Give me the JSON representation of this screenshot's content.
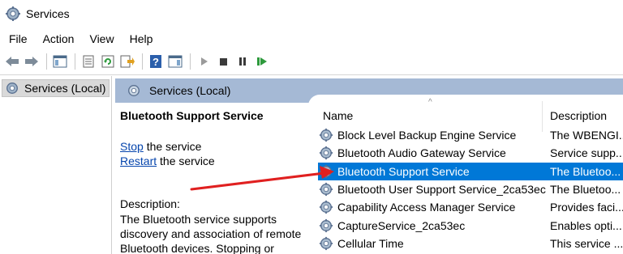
{
  "window": {
    "title": "Services"
  },
  "menu": [
    "File",
    "Action",
    "View",
    "Help"
  ],
  "tree": {
    "root_label": "Services (Local)"
  },
  "pane": {
    "header": "Services (Local)"
  },
  "detail": {
    "service_name": "Bluetooth Support Service",
    "stop_link": "Stop",
    "stop_suffix": " the service",
    "restart_link": "Restart",
    "restart_suffix": " the service",
    "description_label": "Description:",
    "description_lines": [
      "The Bluetooth service supports",
      "discovery and association of remote",
      "Bluetooth devices.  Stopping or"
    ]
  },
  "list": {
    "columns": {
      "name": "Name",
      "description": "Description"
    },
    "rows": [
      {
        "name": "Block Level Backup Engine Service",
        "description": "The WBENGI...",
        "selected": false
      },
      {
        "name": "Bluetooth Audio Gateway Service",
        "description": "Service supp...",
        "selected": false
      },
      {
        "name": "Bluetooth Support Service",
        "description": "The Bluetoo...",
        "selected": true
      },
      {
        "name": "Bluetooth User Support Service_2ca53ec",
        "description": "The Bluetoo...",
        "selected": false
      },
      {
        "name": "Capability Access Manager Service",
        "description": "Provides faci...",
        "selected": false
      },
      {
        "name": "CaptureService_2ca53ec",
        "description": "Enables opti...",
        "selected": false
      },
      {
        "name": "Cellular Time",
        "description": "This service ...",
        "selected": false
      }
    ]
  },
  "colors": {
    "selection": "#0078d7",
    "pane_header": "#a5b9d5",
    "link": "#0645ad",
    "annotation_arrow": "#e02020"
  }
}
